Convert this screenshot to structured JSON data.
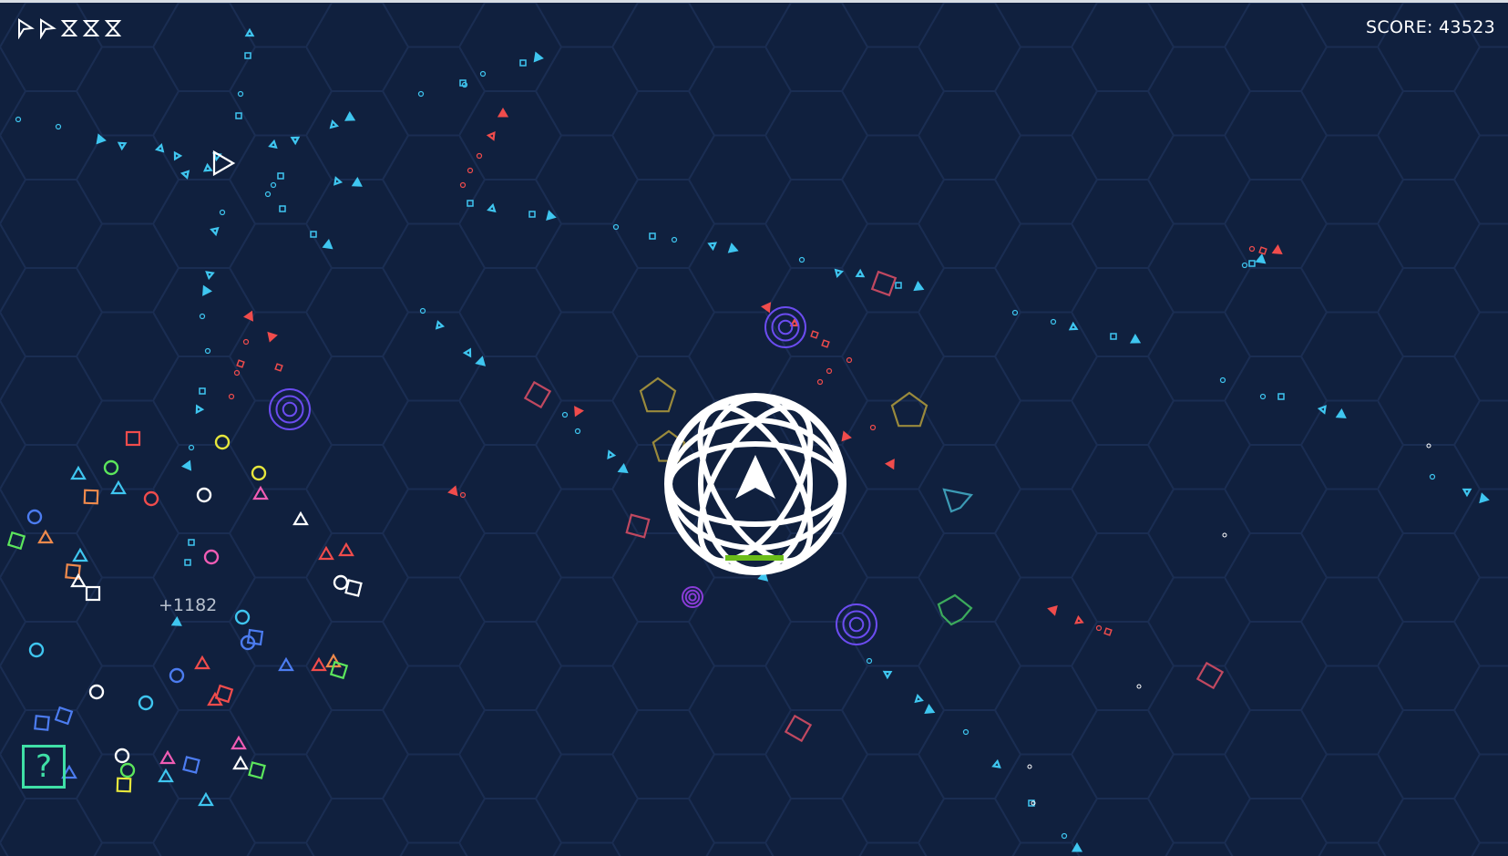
{
  "hud": {
    "score_text": "SCORE: 43523",
    "lives_remaining": 2,
    "bombs_remaining": 3
  },
  "popup": {
    "points_text": "+1182"
  },
  "powerup": {
    "label": "?"
  },
  "player": {
    "shield_active": true,
    "health_fraction": 1.0
  },
  "colors": {
    "background": "#10203e",
    "grid": "#1a2d52",
    "cyan": "#3fc6f0",
    "red": "#f04c4c",
    "white": "#ffffff",
    "green": "#5ce65c",
    "yellow": "#e6e63c",
    "orange": "#f08a4c",
    "pink": "#f05cb4",
    "blue": "#4c7cf0",
    "purple": "#6b4cf0",
    "olive": "#9a8a3c",
    "mint": "#3fe0a6",
    "health": "#6bbd1a"
  }
}
